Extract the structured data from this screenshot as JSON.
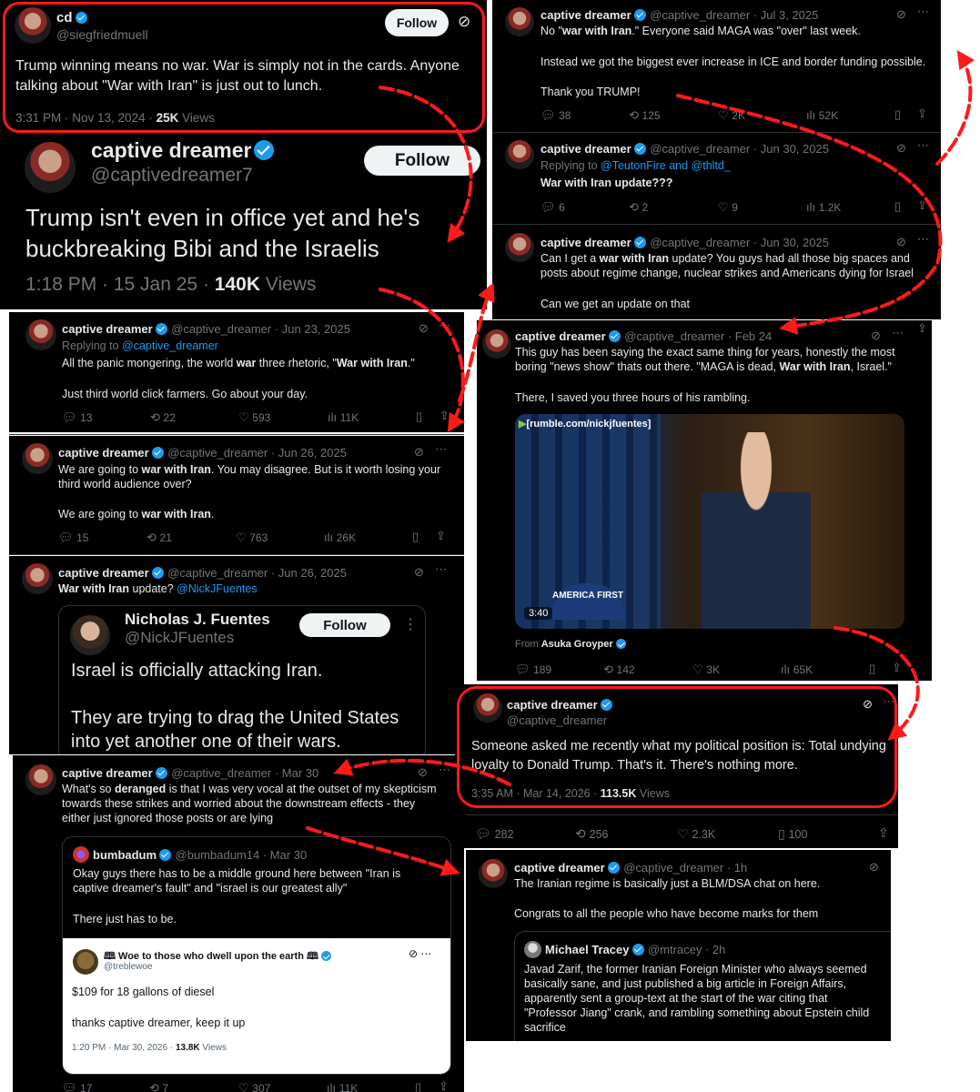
{
  "tweet_cd": {
    "name": "cd",
    "handle": "@siegfriedmuell",
    "follow": "Follow",
    "text": "Trump winning means no war.  War is simply not in the cards.  Anyone talking about \"War with Iran\" is just out to lunch.",
    "time": "3:31 PM · Nov 13, 2024 · ",
    "views_num": "25K",
    "views_label": " Views"
  },
  "tweet_big": {
    "name": "captive dreamer",
    "handle": "@captivedreamer7",
    "follow": "Follow",
    "text": "Trump isn't even in office yet and he's buckbreaking Bibi and the Israelis",
    "time": "1:18 PM · 15 Jan 25 · ",
    "views_num": "140K",
    "views_label": " Views"
  },
  "tweet_jun23": {
    "name": "captive dreamer",
    "meta": "@captive_dreamer · Jun 23, 2025",
    "reply_prefix": "Replying to ",
    "reply_to": "@captive_dreamer",
    "line1_a": "All the panic mongering, the world ",
    "line1_b": "war",
    "line1_c": " three rhetoric, \"",
    "line1_d": "War with Iran",
    "line1_e": ".\"",
    "line2": "Just third world click farmers.  Go about your day.",
    "replies": "13",
    "reposts": "22",
    "likes": "593",
    "views": "11K"
  },
  "tweet_jun26a": {
    "name": "captive dreamer",
    "meta": "@captive_dreamer · Jun 26, 2025",
    "l1a": "We are going to ",
    "l1b": "war with Iran",
    "l1c": ".  You may disagree.  But is it worth losing your",
    "l2": "third world audience over?",
    "l3a": "We are going to ",
    "l3b": "war with Iran",
    "l3c": ".",
    "replies": "15",
    "reposts": "21",
    "likes": "763",
    "views": "26K"
  },
  "tweet_jun26b": {
    "name": "captive dreamer",
    "meta": "@captive_dreamer · Jun 26, 2025",
    "bold": "War with Iran",
    "rest": " update? ",
    "mention": "@NickJFuentes"
  },
  "quote_fuentes": {
    "name": "Nicholas J. Fuentes",
    "handle": "@NickJFuentes",
    "follow": "Follow",
    "line1": "Israel is officially attacking Iran.",
    "line2": "They are trying to drag the United States",
    "line3": "into yet another one of their wars."
  },
  "tweet_mar30": {
    "name": "captive dreamer",
    "meta": "@captive_dreamer · Mar 30",
    "l1a": "What's so ",
    "l1b": "deranged",
    "l1c": " is that I was very vocal at the outset of my skepticism",
    "l2": "towards these strikes and worried about the downstream effects - they",
    "l3": "either just ignored those posts or are lying",
    "replies": "17",
    "reposts": "7",
    "likes": "307",
    "views": "11K"
  },
  "quote_bumbadum": {
    "name": "bumbadum",
    "meta": "@bumbadum14 · Mar 30",
    "l1": "Okay guys there has to be a middle ground here between \"Iran is",
    "l2": "captive dreamer's fault\" and \"israel is our greatest ally\"",
    "l3": "There just has to be."
  },
  "quote_treble": {
    "name": "Woe to those who dwell upon the earth",
    "handle": "@treblewoe",
    "l1": "$109 for 18 gallons of diesel",
    "l2": "thanks captive dreamer, keep it up",
    "time": "1:20 PM · Mar 30, 2026 · ",
    "views_num": "13.8K",
    "views_label": " Views"
  },
  "tweet_jul3": {
    "name": "captive dreamer",
    "meta": "@captive_dreamer · Jul 3, 2025",
    "l1a": "No \"",
    "l1b": "war with Iran",
    "l1c": ".\" Everyone said MAGA was \"over\" last week.",
    "l2": "Instead we got the biggest ever increase in ICE and border funding possible.",
    "l3": "Thank you TRUMP!",
    "replies": "38",
    "reposts": "125",
    "likes": "2K",
    "views": "52K"
  },
  "tweet_jun30a": {
    "name": "captive dreamer",
    "meta": "@captive_dreamer · Jun 30, 2025",
    "reply_prefix": "Replying to ",
    "reply_to": "@TeutonFire and @thltd_",
    "bold": "War with Iran",
    "rest": " update???",
    "replies": "6",
    "reposts": "2",
    "likes": "9",
    "views": "1.2K"
  },
  "tweet_jun30b": {
    "name": "captive dreamer",
    "meta": "@captive_dreamer · Jun 30, 2025",
    "l1a": "Can I get a ",
    "l1b": "war with Iran",
    "l1c": " update?  You guys had all those big spaces and",
    "l2": "posts about regime change, nuclear strikes and Americans dying for Israel",
    "l3": "Can we get an update on that"
  },
  "tweet_feb24": {
    "name": "captive dreamer",
    "meta": "@captive_dreamer · Feb 24",
    "l1": "This guy has been saying the exact same thing for years, honestly the most",
    "l2a": "boring \"news show\" thats out there.  \"MAGA is dead, ",
    "l2b": "War with Iran",
    "l2c": ", Israel.\"",
    "l3": "There, I saved you three hours of his rambling.",
    "video_tag": "[rumble.com/nickjfuentes]",
    "video_time": "3:40",
    "hat_text": "AMERICA FIRST",
    "from_prefix": "From ",
    "from_name": "Asuka Groyper",
    "replies": "189",
    "reposts": "142",
    "likes": "3K",
    "views": "65K"
  },
  "tweet_mar14": {
    "name": "captive dreamer",
    "handle": "@captive_dreamer",
    "text": "Someone asked me recently what my political position is: Total undying loyalty to Donald Trump.  That's it.  There's nothing more.",
    "time": "3:35 AM · Mar 14, 2026 · ",
    "views_num": "113.5K",
    "views_label": " Views",
    "replies": "282",
    "reposts": "256",
    "likes": "2.3K",
    "bookmarks": "100"
  },
  "tweet_1h": {
    "name": "captive dreamer",
    "meta": "@captive_dreamer · 1h",
    "l1": "The Iranian regime is basically just a BLM/DSA chat on here.",
    "l2": "Congrats to all the people who have become marks for them"
  },
  "quote_tracey": {
    "name": "Michael Tracey",
    "meta": "@mtracey · 2h",
    "l1": "Javad Zarif, the former Iranian Foreign Minister who always seemed",
    "l2": "basically sane, and just published a big article in Foreign Affairs,",
    "l3": "apparently sent a group-text at the start of the war citing that",
    "l4": "\"Professor Jiang\" crank, and rambling something about Epstein child",
    "l5": "sacrifice"
  },
  "colors": {
    "accent": "#1d9bf0",
    "annotation_red": "#ff1a1a",
    "background": "#000000"
  }
}
